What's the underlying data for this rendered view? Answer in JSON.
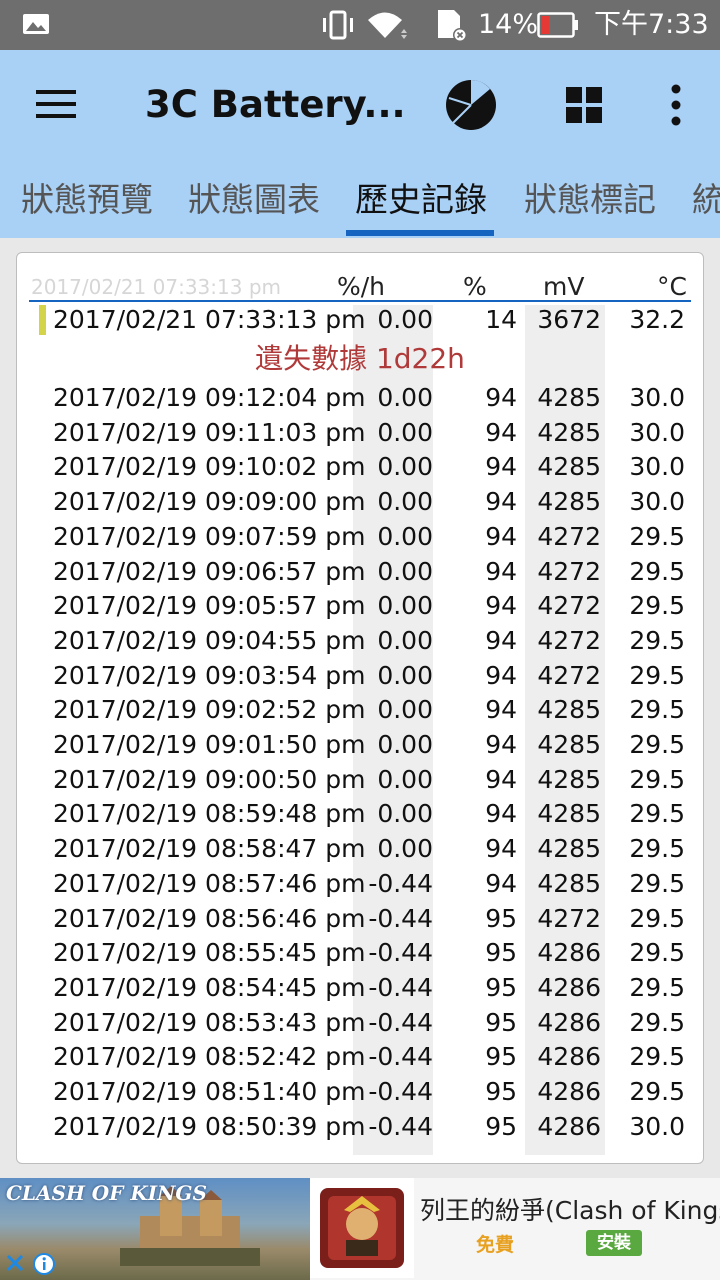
{
  "status_bar": {
    "battery_percent": "14%",
    "time": "下午7:33",
    "icons": [
      "gallery-icon",
      "vibrate-icon",
      "wifi-icon",
      "sd-card-icon",
      "battery-icon"
    ]
  },
  "app_bar": {
    "title": "3C Battery...",
    "icons": [
      "menu-icon",
      "pie-chart-icon",
      "grid-icon",
      "more-icon"
    ]
  },
  "tabs": [
    {
      "label": "狀態預覽"
    },
    {
      "label": "狀態圖表"
    },
    {
      "label": "歷史記錄",
      "active": true
    },
    {
      "label": "狀態標記"
    },
    {
      "label": "統"
    }
  ],
  "history": {
    "header": {
      "date": "2017/02/21 07:33:13 pm",
      "rate": "%/h",
      "percent": "%",
      "voltage": "mV",
      "temperature": "°C"
    },
    "latest": {
      "date": "2017/02/21  07:33:13 pm",
      "rate": "0.00",
      "percent": "14",
      "mv": "3672",
      "temp": "32.2"
    },
    "missing_data": "遺失數據 1d22h",
    "rows": [
      {
        "date": "2017/02/19  09:12:04 pm",
        "rate": "0.00",
        "percent": "94",
        "mv": "4285",
        "temp": "30.0"
      },
      {
        "date": "2017/02/19  09:11:03 pm",
        "rate": "0.00",
        "percent": "94",
        "mv": "4285",
        "temp": "30.0"
      },
      {
        "date": "2017/02/19  09:10:02 pm",
        "rate": "0.00",
        "percent": "94",
        "mv": "4285",
        "temp": "30.0"
      },
      {
        "date": "2017/02/19  09:09:00 pm",
        "rate": "0.00",
        "percent": "94",
        "mv": "4285",
        "temp": "30.0"
      },
      {
        "date": "2017/02/19  09:07:59 pm",
        "rate": "0.00",
        "percent": "94",
        "mv": "4272",
        "temp": "29.5"
      },
      {
        "date": "2017/02/19  09:06:57 pm",
        "rate": "0.00",
        "percent": "94",
        "mv": "4272",
        "temp": "29.5"
      },
      {
        "date": "2017/02/19  09:05:57 pm",
        "rate": "0.00",
        "percent": "94",
        "mv": "4272",
        "temp": "29.5"
      },
      {
        "date": "2017/02/19  09:04:55 pm",
        "rate": "0.00",
        "percent": "94",
        "mv": "4272",
        "temp": "29.5"
      },
      {
        "date": "2017/02/19  09:03:54 pm",
        "rate": "0.00",
        "percent": "94",
        "mv": "4272",
        "temp": "29.5"
      },
      {
        "date": "2017/02/19  09:02:52 pm",
        "rate": "0.00",
        "percent": "94",
        "mv": "4285",
        "temp": "29.5"
      },
      {
        "date": "2017/02/19  09:01:50 pm",
        "rate": "0.00",
        "percent": "94",
        "mv": "4285",
        "temp": "29.5"
      },
      {
        "date": "2017/02/19  09:00:50 pm",
        "rate": "0.00",
        "percent": "94",
        "mv": "4285",
        "temp": "29.5"
      },
      {
        "date": "2017/02/19  08:59:48 pm",
        "rate": "0.00",
        "percent": "94",
        "mv": "4285",
        "temp": "29.5"
      },
      {
        "date": "2017/02/19  08:58:47 pm",
        "rate": "0.00",
        "percent": "94",
        "mv": "4285",
        "temp": "29.5"
      },
      {
        "date": "2017/02/19  08:57:46 pm",
        "rate": "-0.44",
        "percent": "94",
        "mv": "4285",
        "temp": "29.5"
      },
      {
        "date": "2017/02/19  08:56:46 pm",
        "rate": "-0.44",
        "percent": "95",
        "mv": "4272",
        "temp": "29.5"
      },
      {
        "date": "2017/02/19  08:55:45 pm",
        "rate": "-0.44",
        "percent": "95",
        "mv": "4286",
        "temp": "29.5"
      },
      {
        "date": "2017/02/19  08:54:45 pm",
        "rate": "-0.44",
        "percent": "95",
        "mv": "4286",
        "temp": "29.5"
      },
      {
        "date": "2017/02/19  08:53:43 pm",
        "rate": "-0.44",
        "percent": "95",
        "mv": "4286",
        "temp": "29.5"
      },
      {
        "date": "2017/02/19  08:52:42 pm",
        "rate": "-0.44",
        "percent": "95",
        "mv": "4286",
        "temp": "29.5"
      },
      {
        "date": "2017/02/19  08:51:40 pm",
        "rate": "-0.44",
        "percent": "95",
        "mv": "4286",
        "temp": "29.5"
      },
      {
        "date": "2017/02/19  08:50:39 pm",
        "rate": "-0.44",
        "percent": "95",
        "mv": "4286",
        "temp": "30.0"
      }
    ]
  },
  "ad": {
    "game_logo": "CLASH OF KINGS",
    "title": "列王的紛爭(Clash of Kings)",
    "price": "免費",
    "install_label": "安裝",
    "icons": [
      "ad-close-icon",
      "ad-info-icon",
      "app-icon"
    ]
  }
}
